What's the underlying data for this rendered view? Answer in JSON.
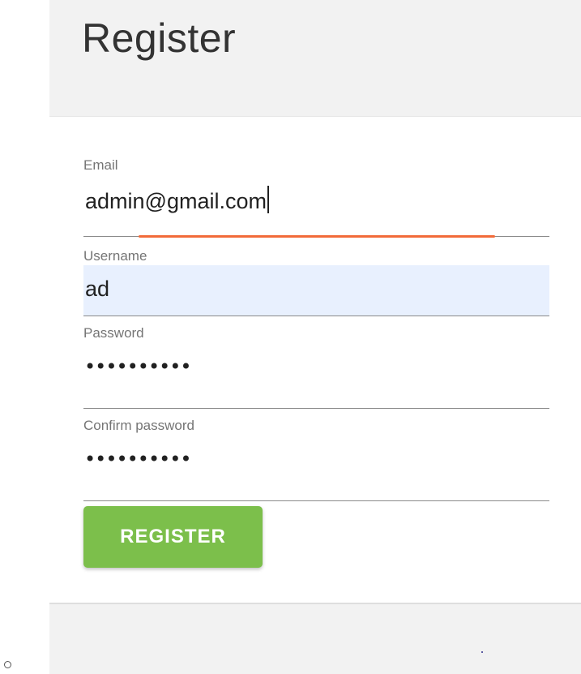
{
  "header": {
    "title": "Register"
  },
  "form": {
    "email": {
      "label": "Email",
      "value": "admin@gmail.com"
    },
    "username": {
      "label": "Username",
      "value": "ad"
    },
    "password": {
      "label": "Password",
      "masked_value": "••••••••••"
    },
    "confirm_password": {
      "label": "Confirm password",
      "masked_value": "••••••••••"
    },
    "submit_label": "REGISTER"
  },
  "colors": {
    "header_bg": "#f2f2f2",
    "button_bg": "#7cbf4b",
    "focus_underline": "#f26b3a",
    "autofill_bg": "#e8f0fe"
  }
}
